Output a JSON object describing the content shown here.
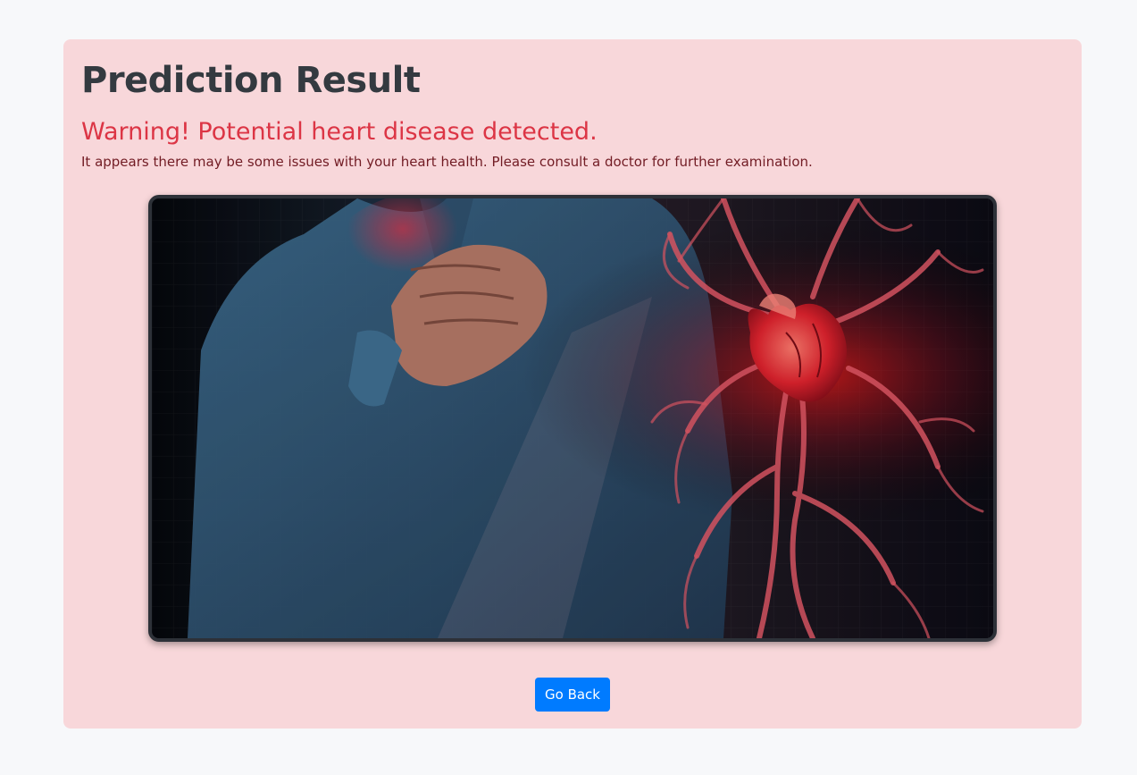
{
  "page": {
    "title": "Prediction Result",
    "warning": "Warning! Potential heart disease detected.",
    "message": "It appears there may be some issues with your heart health. Please consult a doctor for further examination."
  },
  "image": {
    "subject": "person clutching chest beside glowing red anatomical heart illustration",
    "icon": "heart-illustration"
  },
  "actions": {
    "go_back_label": "Go Back"
  },
  "colors": {
    "card_background": "#f8d7da",
    "title": "#343a40",
    "warning": "#dc3545",
    "message": "#721c24",
    "button": "#007bff"
  }
}
